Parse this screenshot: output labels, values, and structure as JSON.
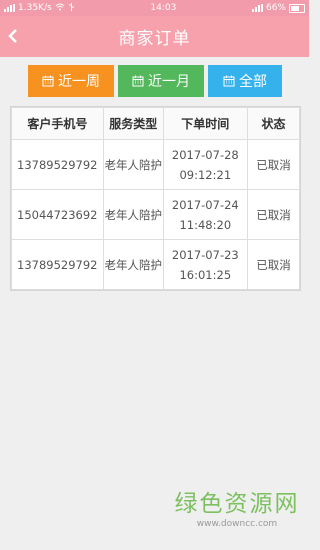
{
  "statusbar": {
    "speed": "1.35K/s",
    "time": "14:03",
    "battery": "66%"
  },
  "header": {
    "title": "商家订单",
    "back_icon": "chevron-left-icon"
  },
  "filters": [
    {
      "label": "近一周",
      "color": "#f7911f"
    },
    {
      "label": "近一月",
      "color": "#53b75b"
    },
    {
      "label": "全部",
      "color": "#35b2ec"
    }
  ],
  "table": {
    "headers": [
      "客户手机号",
      "服务类型",
      "下单时间",
      "状态"
    ],
    "rows": [
      {
        "phone": "13789529792",
        "service": "老年人陪护",
        "date": "2017-07-28",
        "time": "09:12:21",
        "status": "已取消"
      },
      {
        "phone": "15044723692",
        "service": "老年人陪护",
        "date": "2017-07-24",
        "time": "11:48:20",
        "status": "已取消"
      },
      {
        "phone": "13789529792",
        "service": "老年人陪护",
        "date": "2017-07-23",
        "time": "16:01:25",
        "status": "已取消"
      }
    ]
  },
  "watermark": {
    "main": "绿色资源网",
    "sub": "www.downcc.com"
  }
}
